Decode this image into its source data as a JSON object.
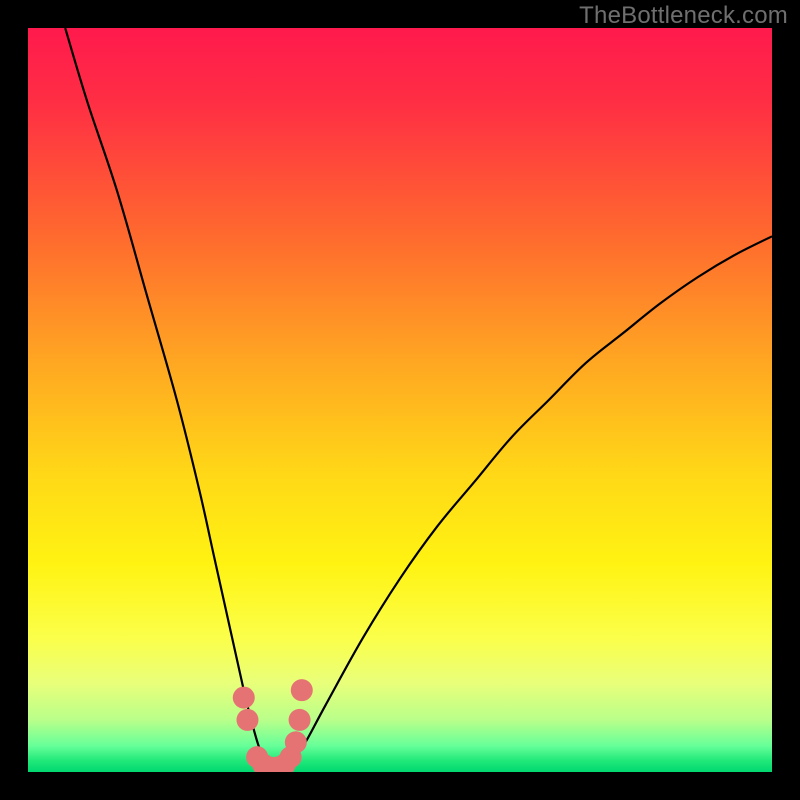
{
  "watermark": "TheBottleneck.com",
  "colors": {
    "frame": "#000000",
    "curve": "#000000",
    "markers": "#e57373",
    "gradient_stops": [
      {
        "offset": 0.0,
        "color": "#ff1a4d"
      },
      {
        "offset": 0.1,
        "color": "#ff2e44"
      },
      {
        "offset": 0.28,
        "color": "#ff6a2e"
      },
      {
        "offset": 0.45,
        "color": "#ffa722"
      },
      {
        "offset": 0.6,
        "color": "#ffd817"
      },
      {
        "offset": 0.72,
        "color": "#fff312"
      },
      {
        "offset": 0.82,
        "color": "#fbff4a"
      },
      {
        "offset": 0.88,
        "color": "#e9ff7a"
      },
      {
        "offset": 0.93,
        "color": "#b9ff8a"
      },
      {
        "offset": 0.965,
        "color": "#66ff99"
      },
      {
        "offset": 0.985,
        "color": "#20e879"
      },
      {
        "offset": 1.0,
        "color": "#00d870"
      }
    ]
  },
  "chart_data": {
    "type": "line",
    "title": "",
    "xlabel": "",
    "ylabel": "",
    "xlim": [
      0,
      100
    ],
    "ylim": [
      0,
      100
    ],
    "series": [
      {
        "name": "bottleneck-curve",
        "x": [
          5,
          8,
          12,
          16,
          20,
          23,
          25,
          27,
          29,
          30,
          31,
          32,
          33,
          34,
          35,
          37,
          40,
          45,
          50,
          55,
          60,
          65,
          70,
          75,
          80,
          85,
          90,
          95,
          100
        ],
        "y": [
          100,
          90,
          78,
          64,
          50,
          38,
          29,
          20,
          11,
          7,
          3.5,
          1.2,
          0.4,
          0.4,
          1.0,
          3.5,
          9,
          18,
          26,
          33,
          39,
          45,
          50,
          55,
          59,
          63,
          66.5,
          69.5,
          72
        ]
      }
    ],
    "markers": {
      "name": "highlight-points",
      "x": [
        29.0,
        29.5,
        30.8,
        31.6,
        32.5,
        33.5,
        34.5,
        35.3,
        36.0,
        36.5,
        36.8
      ],
      "y": [
        10.0,
        7.0,
        2.0,
        1.0,
        0.6,
        0.6,
        1.0,
        2.0,
        4.0,
        7.0,
        11.0
      ]
    }
  }
}
